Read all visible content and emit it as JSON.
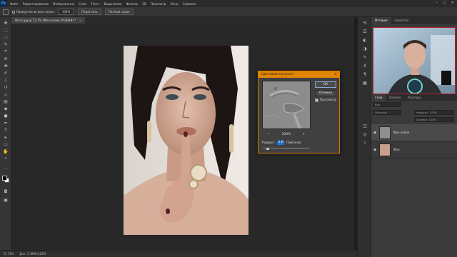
{
  "app": {
    "logo": "Ps"
  },
  "menu": [
    "Файл",
    "Редактирование",
    "Изображение",
    "Слои",
    "Текст",
    "Выделение",
    "Фильтр",
    "3D",
    "Просмотр",
    "Окно",
    "Справка"
  ],
  "window_controls": [
    "–",
    "□",
    "✕"
  ],
  "options_bar": {
    "checkbox_label": "Прокрутка во всех окнах",
    "zoom_value": "100%",
    "fit_button": "Подогнать",
    "fill_button": "Полный экран"
  },
  "document_tab": {
    "title": "Фото.jpg @ 72,7% (Фон копия, RGB/8#) *",
    "close": "×"
  },
  "status_bar": {
    "zoom": "72,73%",
    "doc_info": "Док: 2,38M/4,22M"
  },
  "panel": {
    "tabs": [
      "История",
      "Свойства"
    ],
    "search_placeholder": "Вид",
    "layers_tabs": [
      "Слои",
      "Каналы",
      "Контуры"
    ],
    "blend_mode": "Обычные",
    "opacity": "Непрозр.: 100%",
    "fill": "Заливка: 100%",
    "layers": [
      {
        "name": "Фон копия",
        "visible": true,
        "selected": true
      },
      {
        "name": "Фон",
        "visible": true,
        "selected": false
      }
    ]
  },
  "dialog": {
    "title": "Цветовой контраст",
    "close": "×",
    "ok": "ОК",
    "cancel": "Отмена",
    "preview_label": "Просмотр",
    "preview_checked": true,
    "zoom_out": "−",
    "zoom_value": "100%",
    "zoom_in": "+",
    "radius_label": "Радиус:",
    "radius_value": "1,6",
    "radius_unit": "Пиксели",
    "radius_slider_fraction": 0.1
  },
  "colors": {
    "accent": "#e08500",
    "selection": "#1f6fd0",
    "webcam_border": "#b3202a"
  }
}
